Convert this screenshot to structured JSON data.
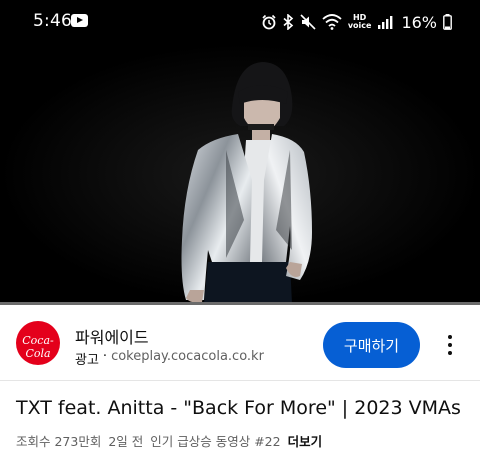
{
  "status_bar": {
    "time": "5:46",
    "hd_line1": "HD",
    "hd_line2": "voice",
    "battery": "16%",
    "icons": [
      "youtube-notification-icon",
      "alarm-icon",
      "bluetooth-icon",
      "mute-icon",
      "wifi-icon",
      "hd-voice-icon",
      "signal-icon",
      "battery-icon"
    ]
  },
  "player": {
    "progress_fraction": 0.0,
    "progress_color": "#ee0000"
  },
  "ad": {
    "logo_text": "Coca-Cola",
    "advertiser": "파워에이드",
    "badge": "광고",
    "dot": "·",
    "url": "cokeplay.cocacola.co.kr",
    "cta_label": "구매하기",
    "cta_color": "#065fd4"
  },
  "video": {
    "title": "TXT feat. Anitta - \"Back For More\" | 2023 VMAs",
    "views": "조회수 273만회",
    "age": "2일 전",
    "trending": "인기 급상승 동영상 #22",
    "more_label": "더보기"
  }
}
